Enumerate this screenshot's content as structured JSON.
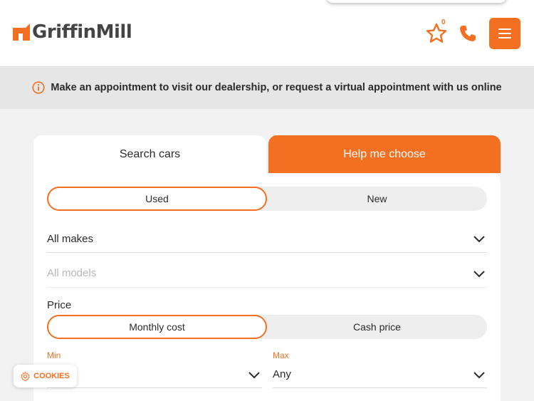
{
  "brand": {
    "name_part1": "Griffin",
    "name_part2": "Mill",
    "accent": "#f36f21"
  },
  "header": {
    "favourites_count": "0",
    "icons": [
      "star-icon",
      "phone-icon",
      "menu-icon"
    ]
  },
  "banner": {
    "text": "Make an appointment to visit our dealership, or request a virtual appointment with us online",
    "icon": "info-icon"
  },
  "tabs": [
    {
      "label": "Search cars"
    },
    {
      "label": "Help me choose"
    }
  ],
  "condition": {
    "options": [
      {
        "label": "Used"
      },
      {
        "label": "New"
      }
    ],
    "selected": "Used"
  },
  "makes": {
    "value": "All makes"
  },
  "models": {
    "value": "All models"
  },
  "price": {
    "label": "Price",
    "options": [
      {
        "label": "Monthly cost"
      },
      {
        "label": "Cash price"
      }
    ],
    "selected": "Monthly cost",
    "min": {
      "label": "Min",
      "value": ""
    },
    "max": {
      "label": "Max",
      "value": "Any"
    }
  },
  "cookies": {
    "label": "COOKIES"
  }
}
